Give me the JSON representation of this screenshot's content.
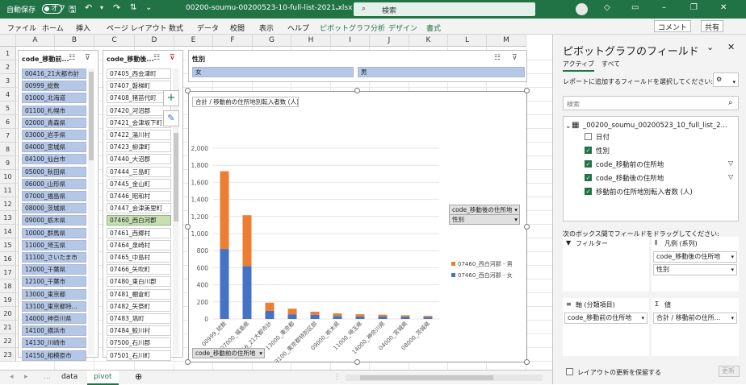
{
  "titlebar": {
    "autosave": "自動保存",
    "autosave_state": "オフ",
    "filename": "00200-soumu-00200523-10-full-list-2021.xlsx",
    "search_placeholder": "検索"
  },
  "menu": [
    "ファイル",
    "ホーム",
    "挿入",
    "ページ レイアウト",
    "数式",
    "データ",
    "校閲",
    "表示",
    "ヘルプ",
    "ピボットグラフ分析",
    "デザイン",
    "書式"
  ],
  "menu_right": {
    "comment": "コメント",
    "share": "共有"
  },
  "columns": [
    "A",
    "B",
    "C",
    "D",
    "E",
    "F",
    "G",
    "H",
    "I",
    "J",
    "K",
    "L",
    "M"
  ],
  "rows": [
    "1",
    "2",
    "3",
    "4",
    "5",
    "6",
    "7",
    "8",
    "9",
    "10",
    "11",
    "12",
    "13",
    "14",
    "15",
    "16",
    "17",
    "18",
    "19",
    "20",
    "21",
    "22",
    "23"
  ],
  "slicer1": {
    "title": "code_移動前...",
    "items": [
      "00416_21大都市計",
      "00999_総数",
      "01000_北海道",
      "01100_札幌市",
      "02000_青森県",
      "03000_岩手県",
      "04000_宮城県",
      "04100_仙台市",
      "05000_秋田県",
      "06000_山形県",
      "07000_福島県",
      "08000_茨城県",
      "09000_栃木県",
      "10000_群馬県",
      "11000_埼玉県",
      "11100_さいたま市",
      "12000_千葉県",
      "12100_千葉市",
      "13000_東京都",
      "13100_東京都特...",
      "14000_神奈川県",
      "14100_横浜市",
      "14130_川崎市",
      "14150_相模原市"
    ]
  },
  "slicer2": {
    "title": "code_移動後...",
    "items": [
      "07405_西会津町",
      "07407_磐梯町",
      "07408_猪苗代町",
      "07420_河沼郡",
      "07421_会津坂下町",
      "07422_湯川村",
      "07423_柳津町",
      "07440_大沼郡",
      "07444_三島町",
      "07445_金山町",
      "07446_昭和村",
      "07447_会津美里町",
      "07460_西白河郡",
      "07461_西郷村",
      "07464_泉崎村",
      "07465_中島村",
      "07466_矢吹町",
      "07480_東白川郡",
      "07481_棚倉町",
      "07482_矢祭町",
      "07483_塙町",
      "07484_鮫川村",
      "07500_石川郡",
      "07501_石川町"
    ],
    "selected": "07460_西白河郡"
  },
  "slicer3": {
    "title": "性別",
    "items": [
      "女",
      "男"
    ]
  },
  "chart_data": {
    "type": "bar",
    "stacked": true,
    "title": "合計 / 移動前の住所地別転入者数 (人)",
    "categories": [
      "00999_総数",
      "07000_福島県",
      "00416_21大都市計",
      "13000_東京都",
      "13100_東京都特別区部",
      "09000_栃木県",
      "11000_埼玉県",
      "14000_神奈川県",
      "04000_宮城県",
      "08000_茨城県"
    ],
    "series": [
      {
        "name": "07460_西白河郡 - 女",
        "color": "#4472c4",
        "values": [
          820,
          620,
          95,
          55,
          50,
          35,
          30,
          28,
          25,
          22
        ]
      },
      {
        "name": "07460_西白河郡 - 男",
        "color": "#ed7d31",
        "values": [
          910,
          595,
          95,
          65,
          35,
          30,
          25,
          22,
          18,
          15
        ]
      }
    ],
    "ylim": [
      0,
      2000
    ],
    "yticks": [
      0,
      200,
      400,
      600,
      800,
      1000,
      1200,
      1400,
      1600,
      1800,
      2000
    ],
    "grid": true,
    "legend_title": "code_移動後の住所地",
    "legend_sub": "性別",
    "axis_field_button": "code_移動前の住所地"
  },
  "tabs": [
    "data",
    "pivot"
  ],
  "panel": {
    "title": "ピボットグラフのフィールド",
    "tab_active": "アクティブ",
    "tab_all": "すべて",
    "instruction": "レポートに追加するフィールドを選択してください:",
    "search_placeholder": "検索",
    "table_name": "_00200_soumu_00200523_10_full_list_2...",
    "fields": [
      {
        "label": "日付",
        "checked": false
      },
      {
        "label": "性別",
        "checked": true
      },
      {
        "label": "code_移動前の住所地",
        "checked": true
      },
      {
        "label": "code_移動後の住所地",
        "checked": true
      },
      {
        "label": "移動前の住所地別転入者数 (人)",
        "checked": true
      }
    ],
    "drag_note": "次のボックス間でフィールドをドラッグしてください:",
    "filters_label": "フィルター",
    "legend_label": "凡例 (系列)",
    "legend_items": [
      "code_移動後の住所地",
      "性別"
    ],
    "axis_label": "軸 (分類項目)",
    "axis_items": [
      "code_移動前の住所地"
    ],
    "values_label": "値",
    "values_items": [
      "合計 / 移動前の住所..."
    ],
    "defer_label": "レイアウトの更新を保留する",
    "update_label": "更新"
  }
}
